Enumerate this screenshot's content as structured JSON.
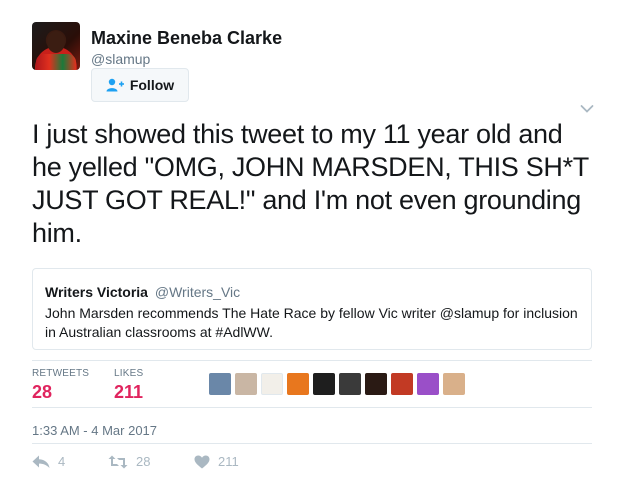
{
  "author": {
    "name": "Maxine Beneba Clarke",
    "handle": "@slamup",
    "follow_label": "Follow"
  },
  "tweet": {
    "text": "I just showed this tweet to my 11 year old and he yelled \"OMG, JOHN MARSDEN, THIS SH*T JUST GOT REAL!\" and I'm not even grounding him.",
    "timestamp": "1:33 AM - 4 Mar 2017"
  },
  "quoted_tweet": {
    "name": "Writers Victoria",
    "handle": "@Writers_Vic",
    "text": "John Marsden recommends  The Hate Race by fellow Vic writer @slamup for inclusion in Australian classrooms at #AdlWW."
  },
  "stats": {
    "retweets_label": "RETWEETS",
    "retweets_value": "28",
    "likes_label": "LIKES",
    "likes_value": "211"
  },
  "likers": [
    {
      "color": "#6a87a8"
    },
    {
      "color": "#c9b6a4"
    },
    {
      "color": "#f2efe9"
    },
    {
      "color": "#e8771e"
    },
    {
      "color": "#1e1e1e"
    },
    {
      "color": "#3a3a3a"
    },
    {
      "color": "#2a1a14"
    },
    {
      "color": "#c23a24"
    },
    {
      "color": "#9a4fc8"
    },
    {
      "color": "#d9b08a"
    }
  ],
  "actions": {
    "reply_count": "4",
    "retweet_count": "28",
    "like_count": "211"
  },
  "colors": {
    "accent_like": "#e0245e",
    "muted": "#657786",
    "border": "#e1e8ed"
  }
}
